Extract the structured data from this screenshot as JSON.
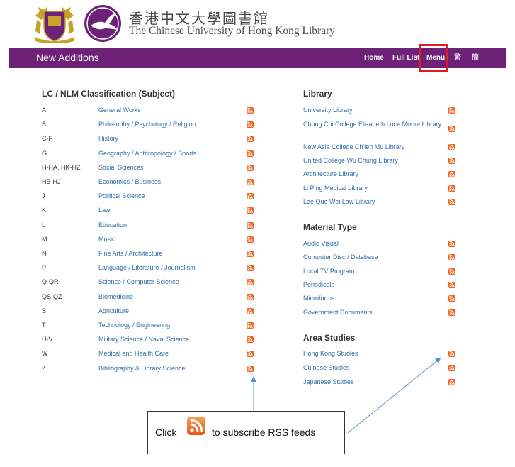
{
  "header": {
    "name_zh": "香港中文大學圖書館",
    "name_en": "The Chinese University of Hong Kong Library"
  },
  "topbar": {
    "title": "New Additions",
    "nav": {
      "home": "Home",
      "full_list": "Full List",
      "menu": "Menu",
      "traditional": "繁",
      "simplified": "簡"
    }
  },
  "lc": {
    "heading": "LC / NLM Classification (Subject)",
    "items": [
      {
        "code": "A",
        "label": "General Works"
      },
      {
        "code": "B",
        "label": "Philosophy / Psychology / Religion"
      },
      {
        "code": "C-F",
        "label": "History"
      },
      {
        "code": "G",
        "label": "Geography / Anthropology / Sports"
      },
      {
        "code": "H-HA, HK-HZ",
        "label": "Social Sciences"
      },
      {
        "code": "HB-HJ",
        "label": "Economics / Business"
      },
      {
        "code": "J",
        "label": "Political Science"
      },
      {
        "code": "K",
        "label": "Law"
      },
      {
        "code": "L",
        "label": "Education"
      },
      {
        "code": "M",
        "label": "Music"
      },
      {
        "code": "N",
        "label": "Fine Arts / Architecture"
      },
      {
        "code": "P",
        "label": "Language / Literature / Journalism"
      },
      {
        "code": "Q-QR",
        "label": "Science / Computer Science"
      },
      {
        "code": "QS-QZ",
        "label": "Biomedicine"
      },
      {
        "code": "S",
        "label": "Agriculture"
      },
      {
        "code": "T",
        "label": "Technology / Engineering"
      },
      {
        "code": "U-V",
        "label": "Military Science / Naval Science"
      },
      {
        "code": "W",
        "label": "Medical and Health Care"
      },
      {
        "code": "Z",
        "label": "Bibliography & Library Science"
      }
    ]
  },
  "library": {
    "heading": "Library",
    "items": [
      "University Library",
      "Chung Chi College Elisabeth Luce Moore Library",
      "New Asia College Ch'ien Mu Library",
      "United College Wu Chung Library",
      "Architecture Library",
      "Li Ping Medical Library",
      "Lee Quo Wei Law Library"
    ]
  },
  "material": {
    "heading": "Material Type",
    "items": [
      "Audio Visual",
      "Computer Disc / Database",
      "Local TV Program",
      "Periodicals",
      "Microforms",
      "Government Documents"
    ]
  },
  "area": {
    "heading": "Area Studies",
    "items": [
      "Hong Kong Studies",
      "Chinese Studies",
      "Japanese Studies"
    ]
  },
  "annotation": {
    "click": "Click",
    "rest": "to subscribe RSS feeds"
  },
  "icons": {
    "rss": "rss-icon",
    "bird": "cuhk-bird-logo",
    "seal": "cuhk-crest"
  },
  "colors": {
    "brand_purple": "#6d2177",
    "rss_orange": "#f26522",
    "link_blue": "#2f6ea8",
    "highlight_red": "#e01b24"
  }
}
